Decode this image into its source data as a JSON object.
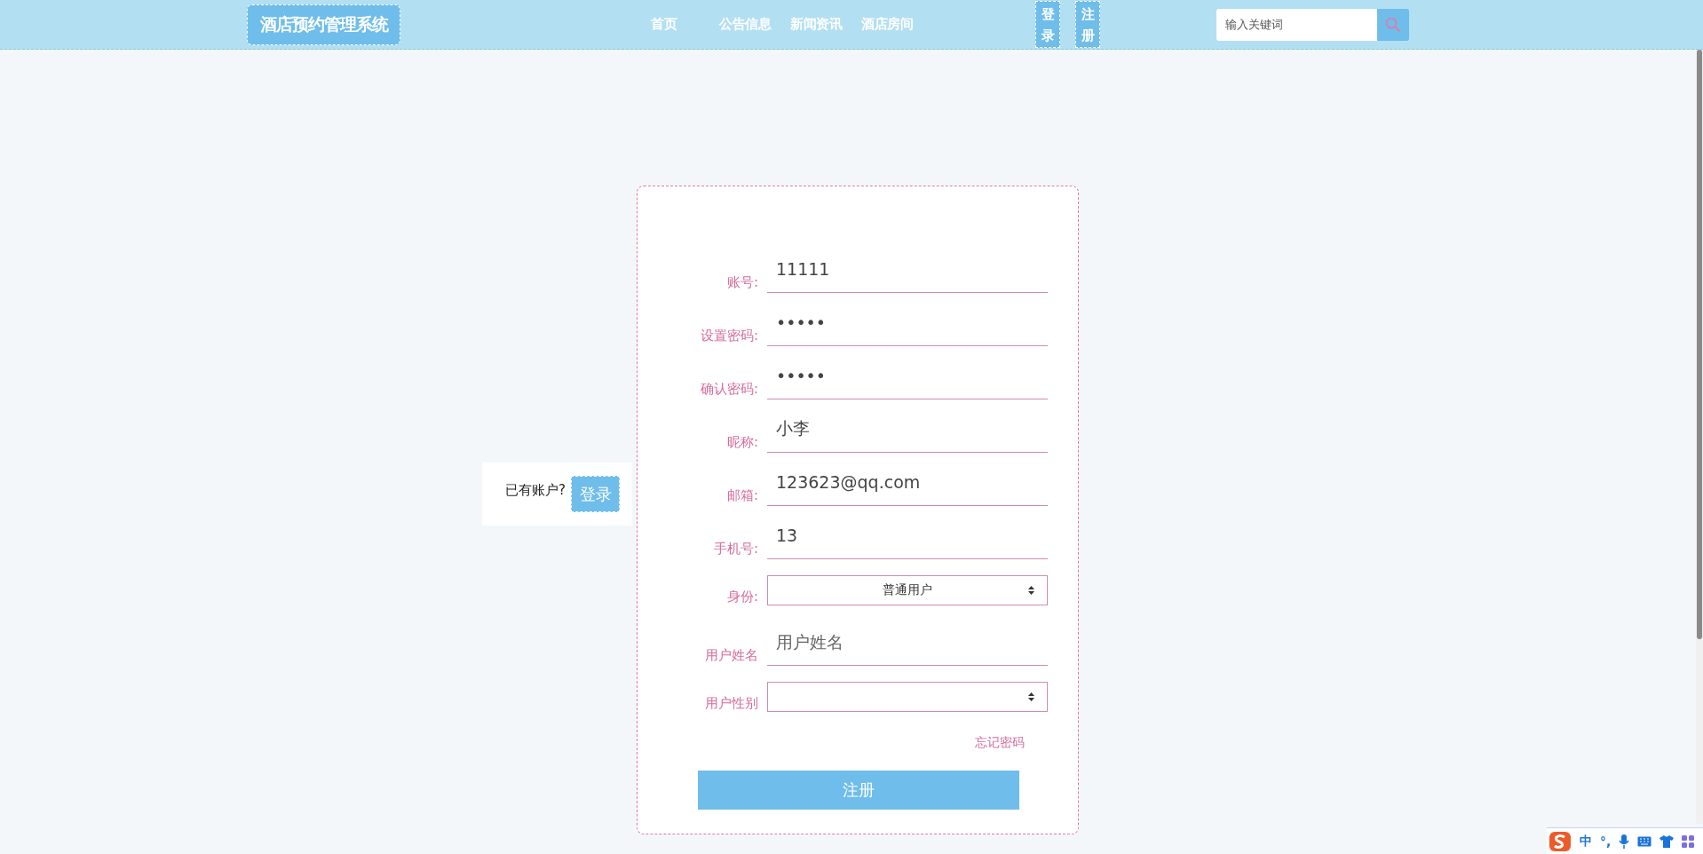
{
  "header": {
    "logo": "酒店预约管理系统",
    "nav": [
      {
        "label": "首页"
      },
      {
        "label": "公告信息"
      },
      {
        "label": "新闻资讯"
      },
      {
        "label": "酒店房间"
      }
    ],
    "auth_buttons": [
      {
        "label": "登录"
      },
      {
        "label": "注册"
      }
    ],
    "search": {
      "placeholder": "输入关键词"
    }
  },
  "login_prompt": {
    "text": "已有账户?",
    "button": "登录"
  },
  "form": {
    "fields": [
      {
        "label": "账号:",
        "kind": "text",
        "value": "11111"
      },
      {
        "label": "设置密码:",
        "kind": "text",
        "value": "•••••"
      },
      {
        "label": "确认密码:",
        "kind": "text",
        "value": "•••••"
      },
      {
        "label": "昵称:",
        "kind": "text",
        "value": "小李"
      },
      {
        "label": "邮箱:",
        "kind": "text",
        "value": "123623@qq.com"
      },
      {
        "label": "手机号:",
        "kind": "text",
        "value": "13"
      },
      {
        "label": "身份:",
        "kind": "select",
        "value": "普通用户"
      },
      {
        "label": "用户姓名",
        "kind": "text",
        "placeholder": "用户姓名"
      },
      {
        "label": "用户性别",
        "kind": "select"
      }
    ],
    "forgot_link": "忘记密码",
    "submit": "注册"
  },
  "ime_toolbar": {
    "items": [
      "中",
      "°,"
    ]
  }
}
